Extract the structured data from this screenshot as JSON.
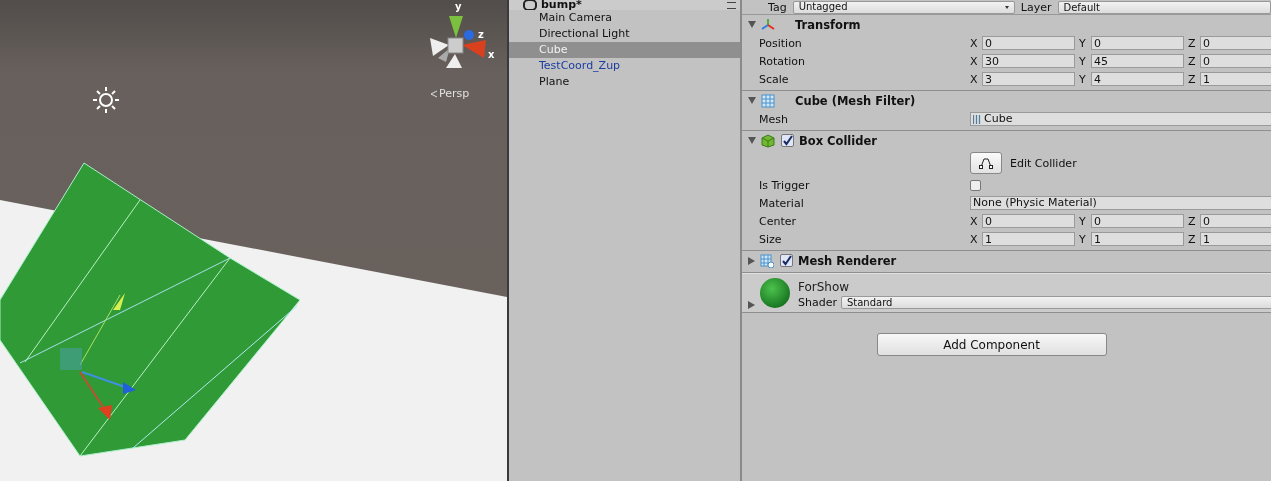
{
  "scene": {
    "gizmo_labels": [
      {
        "axis": "y"
      },
      {
        "axis": "z"
      },
      {
        "axis": "x"
      }
    ],
    "projection": "Persp"
  },
  "hierarchy": {
    "scene_name": "bump*",
    "items": [
      {
        "name": "Main Camera",
        "selected": false,
        "prefab": false
      },
      {
        "name": "Directional Light",
        "selected": false,
        "prefab": false
      },
      {
        "name": "Cube",
        "selected": true,
        "prefab": false
      },
      {
        "name": "TestCoord_Zup",
        "selected": false,
        "prefab": true
      },
      {
        "name": "Plane",
        "selected": false,
        "prefab": false
      }
    ]
  },
  "inspector": {
    "tag_label": "Tag",
    "tag": "Untagged",
    "layer_label": "Layer",
    "layer": "Default",
    "components": [
      {
        "kind": "transform",
        "title": "Transform",
        "expanded": true,
        "fields": [
          {
            "kind": "vector",
            "label": "Position",
            "values": [
              {
                "axis": "X",
                "value": "0"
              },
              {
                "axis": "Y",
                "value": "0"
              },
              {
                "axis": "Z",
                "value": "0"
              }
            ]
          },
          {
            "kind": "vector",
            "label": "Rotation",
            "values": [
              {
                "axis": "X",
                "value": "30"
              },
              {
                "axis": "Y",
                "value": "45"
              },
              {
                "axis": "Z",
                "value": "0"
              }
            ]
          },
          {
            "kind": "vector",
            "label": "Scale",
            "values": [
              {
                "axis": "X",
                "value": "3"
              },
              {
                "axis": "Y",
                "value": "4"
              },
              {
                "axis": "Z",
                "value": "1"
              }
            ]
          }
        ]
      },
      {
        "kind": "mesh-filter",
        "title": "Cube (Mesh Filter)",
        "expanded": true,
        "fields": [
          {
            "kind": "object",
            "label": "Mesh",
            "value": "Cube",
            "mesh_icon": true
          }
        ]
      },
      {
        "kind": "box-collider",
        "title": "Box Collider",
        "expanded": true,
        "enabled": true,
        "fields": [
          {
            "kind": "button",
            "label": "Edit Collider"
          },
          {
            "kind": "checkbox",
            "label": "Is Trigger",
            "checked": false
          },
          {
            "kind": "object",
            "label": "Material",
            "value": "None (Physic Material)",
            "mesh_icon": false
          },
          {
            "kind": "vector",
            "label": "Center",
            "values": [
              {
                "axis": "X",
                "value": "0"
              },
              {
                "axis": "Y",
                "value": "0"
              },
              {
                "axis": "Z",
                "value": "0"
              }
            ]
          },
          {
            "kind": "vector",
            "label": "Size",
            "values": [
              {
                "axis": "X",
                "value": "1"
              },
              {
                "axis": "Y",
                "value": "1"
              },
              {
                "axis": "Z",
                "value": "1"
              }
            ]
          }
        ]
      },
      {
        "kind": "mesh-renderer",
        "title": "Mesh Renderer",
        "expanded": false,
        "enabled": true
      }
    ],
    "material": {
      "name": "ForShow",
      "shader_label": "Shader",
      "shader": "Standard"
    },
    "add_button": "Add Component"
  }
}
